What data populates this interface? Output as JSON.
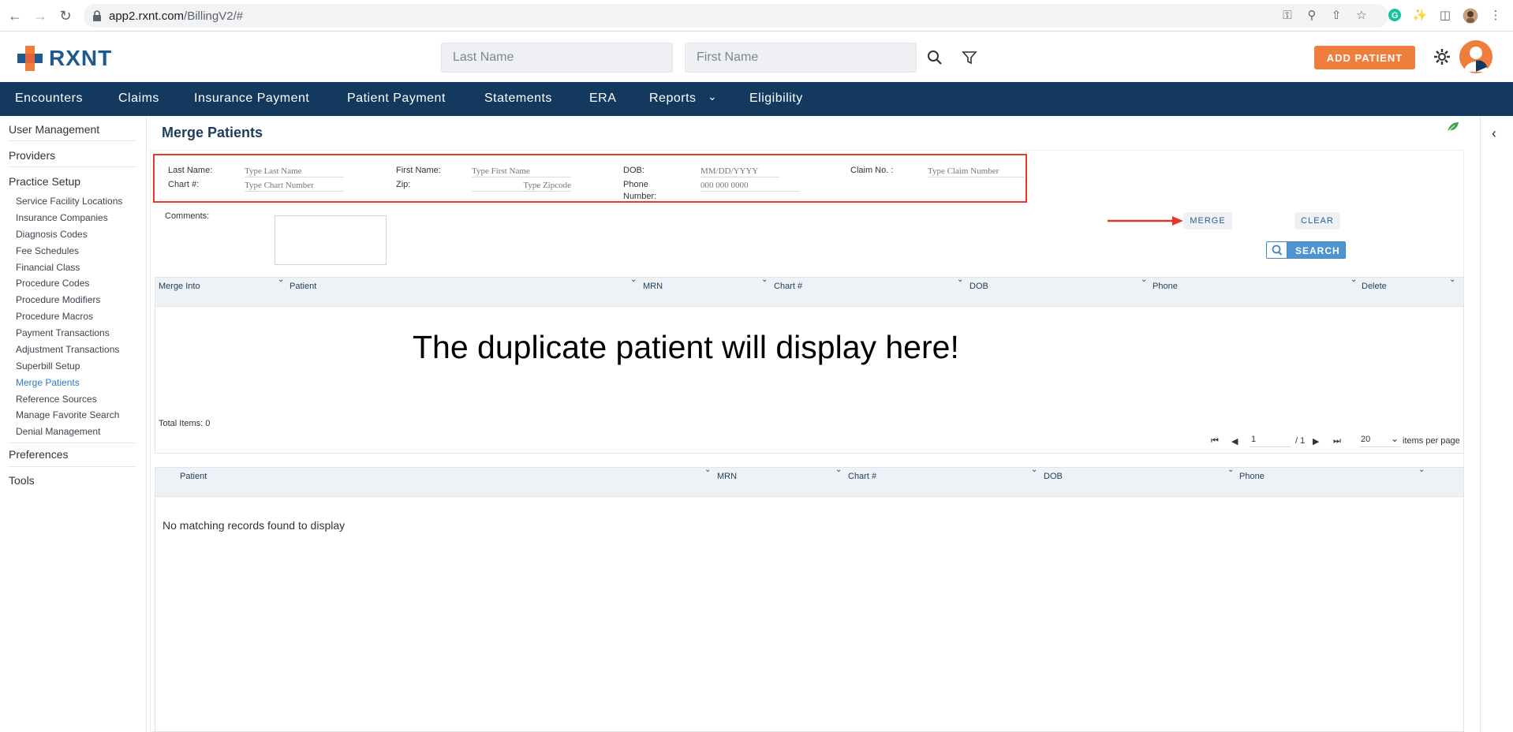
{
  "browser": {
    "url_host": "app2.rxnt.com",
    "url_path": "/BillingV2/#"
  },
  "header": {
    "logo_text": "RXNT",
    "last_name_placeholder": "Last Name",
    "first_name_placeholder": "First Name",
    "add_patient_label": "ADD PATIENT"
  },
  "nav": {
    "items": [
      "Encounters",
      "Claims",
      "Insurance Payment",
      "Patient Payment",
      "Statements",
      "ERA",
      "Reports",
      "Eligibility"
    ]
  },
  "sidebar": {
    "main_items": [
      "User Management",
      "Providers",
      "Practice Setup",
      "Preferences",
      "Tools"
    ],
    "sub_items": [
      "Service Facility Locations",
      "Insurance Companies",
      "Diagnosis Codes",
      "Fee Schedules",
      "Financial Class",
      "Procedure Codes",
      "Procedure Modifiers",
      "Procedure Macros",
      "Payment Transactions",
      "Adjustment Transactions",
      "Superbill Setup",
      "Merge Patients",
      "Reference Sources",
      "Manage Favorite Search",
      "Denial Management"
    ],
    "active_sub": "Merge Patients"
  },
  "page": {
    "title": "Merge Patients"
  },
  "form": {
    "last_name_label": "Last Name:",
    "last_name_placeholder": "Type Last Name",
    "chart_label": "Chart #:",
    "chart_placeholder": "Type Chart Number",
    "first_name_label": "First Name:",
    "first_name_placeholder": "Type First Name",
    "zip_label": "Zip:",
    "zip_placeholder": "Type Zipcode",
    "dob_label": "DOB:",
    "dob_placeholder": "MM/DD/YYYY",
    "phone_label_1": "Phone",
    "phone_label_2": "Number:",
    "phone_placeholder": "000 000 0000",
    "claim_label": "Claim No. :",
    "claim_placeholder": "Type Claim Number",
    "comments_label": "Comments:"
  },
  "actions": {
    "merge": "MERGE",
    "clear": "CLEAR",
    "search": "SEARCH"
  },
  "grid1": {
    "columns": [
      "Merge Into",
      "Patient",
      "MRN",
      "Chart #",
      "DOB",
      "Phone",
      "Delete"
    ],
    "message": "The duplicate patient will display here!",
    "total_items": "Total Items: 0",
    "page_value": "1",
    "page_total": "/ 1",
    "page_size": "20",
    "items_per_page": "items per page"
  },
  "grid2": {
    "columns": [
      "Patient",
      "MRN",
      "Chart #",
      "DOB",
      "Phone"
    ],
    "empty_message": "No matching records found to display"
  },
  "colors": {
    "nav_bg": "#13395e",
    "accent_orange": "#ef7d3c",
    "highlight_red": "#e13b2b",
    "link_blue": "#2f7bc0"
  }
}
